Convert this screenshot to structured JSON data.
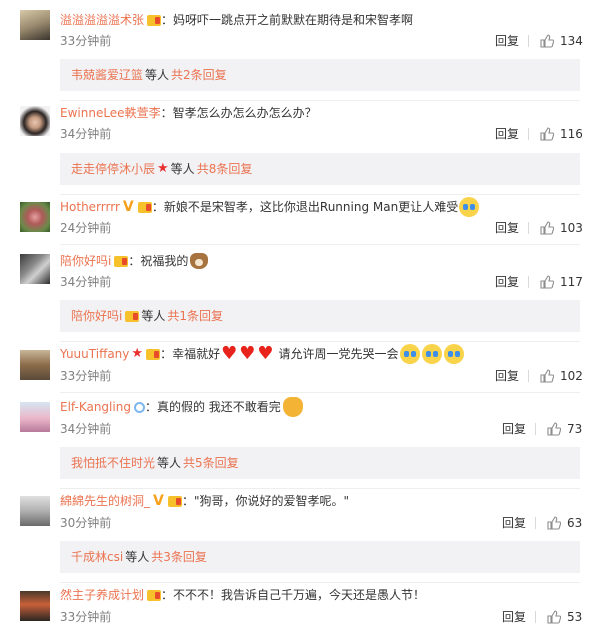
{
  "comments": [
    {
      "user": "溢溢溢溢溢术张",
      "text": "：妈呀吓一跳点开之前默默在期待是和宋智孝啊",
      "time": "33分钟前",
      "reply": "回复",
      "likes": "134",
      "subreply": {
        "user": "韦兢酱爱辽篮",
        "mid": "等人",
        "link": "共2条回复"
      }
    },
    {
      "user": "EwinneLee軼萱李",
      "text": "：智孝怎么办怎么办怎么办？",
      "time": "34分钟前",
      "reply": "回复",
      "likes": "116",
      "subreply": {
        "user": "走走停停沐小辰",
        "mid": "等人",
        "link": "共8条回复"
      }
    },
    {
      "user": "Hotherrrrr",
      "text": "：新娘不是宋智孝，这比你退出Running Man更让人难受",
      "time": "24分钟前",
      "reply": "回复",
      "likes": "103"
    },
    {
      "user": "陪你好吗i",
      "text": "：祝福我的",
      "time": "34分钟前",
      "reply": "回复",
      "likes": "117",
      "subreply": {
        "user": "陪你好吗i",
        "mid": "等人",
        "link": "共1条回复"
      }
    },
    {
      "user": "YuuuTiffany",
      "text_a": "：幸福就好",
      "text_b": "请允许周一党先哭一会",
      "time": "33分钟前",
      "reply": "回复",
      "likes": "102"
    },
    {
      "user": "Elf-Kangling",
      "text": "：真的假的 我还不敢看完",
      "time": "34分钟前",
      "reply": "回复",
      "likes": "73",
      "subreply": {
        "user": "我怕抵不住时光",
        "mid": "等人",
        "link": "共5条回复"
      }
    },
    {
      "user": "綿綿先生的树洞_",
      "text": "：\"狗哥，你说好的爱智孝呢。\"",
      "time": "30分钟前",
      "reply": "回复",
      "likes": "63",
      "subreply": {
        "user": "千成林csi",
        "mid": "等人",
        "link": "共3条回复"
      }
    },
    {
      "user": "然主子养成计划",
      "text": "：不不不！我告诉自己千万遍，今天还是愚人节！",
      "time": "33分钟前",
      "reply": "回复",
      "likes": "53"
    }
  ],
  "icons": {
    "like": "thumbs-up-icon",
    "verified": "verified-v-icon",
    "vip": "vip-badge-icon"
  },
  "colors": {
    "username": "#eb7350",
    "time": "#808080",
    "subreply_bg": "#f2f2f5"
  }
}
